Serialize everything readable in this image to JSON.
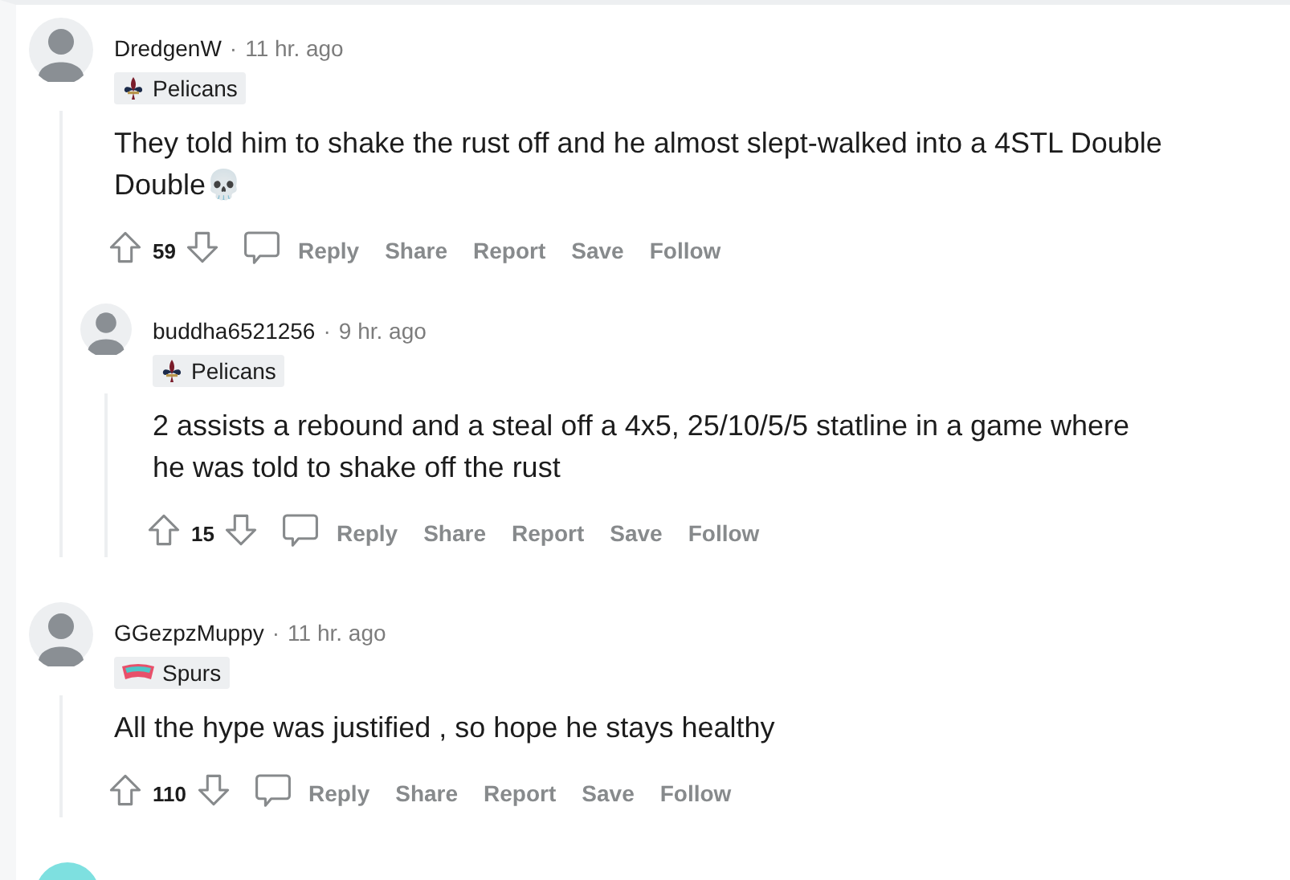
{
  "comments": [
    {
      "username": "DredgenW",
      "separator": "·",
      "time": "11 hr. ago",
      "flair": {
        "kind": "fleur",
        "label": "Pelicans"
      },
      "body": "They told him to shake the rust off and he almost slept-walked into a 4STL Double Double💀",
      "score": "59",
      "actions": [
        "Reply",
        "Share",
        "Report",
        "Save",
        "Follow"
      ],
      "children": [
        {
          "username": "buddha6521256",
          "separator": "·",
          "time": "9 hr. ago",
          "flair": {
            "kind": "fleur",
            "label": "Pelicans"
          },
          "body": "2 assists a rebound and a steal off a 4x5, 25/10/5/5 statline in a game where he was told to shake off the rust",
          "score": "15",
          "actions": [
            "Reply",
            "Share",
            "Report",
            "Save",
            "Follow"
          ]
        }
      ]
    },
    {
      "username": "GGezpzMuppy",
      "separator": "·",
      "time": "11 hr. ago",
      "flair": {
        "kind": "banner",
        "label": "Spurs"
      },
      "body": "All the hype was justified , so hope he stays healthy",
      "score": "110",
      "actions": [
        "Reply",
        "Share",
        "Report",
        "Save",
        "Follow"
      ]
    }
  ]
}
